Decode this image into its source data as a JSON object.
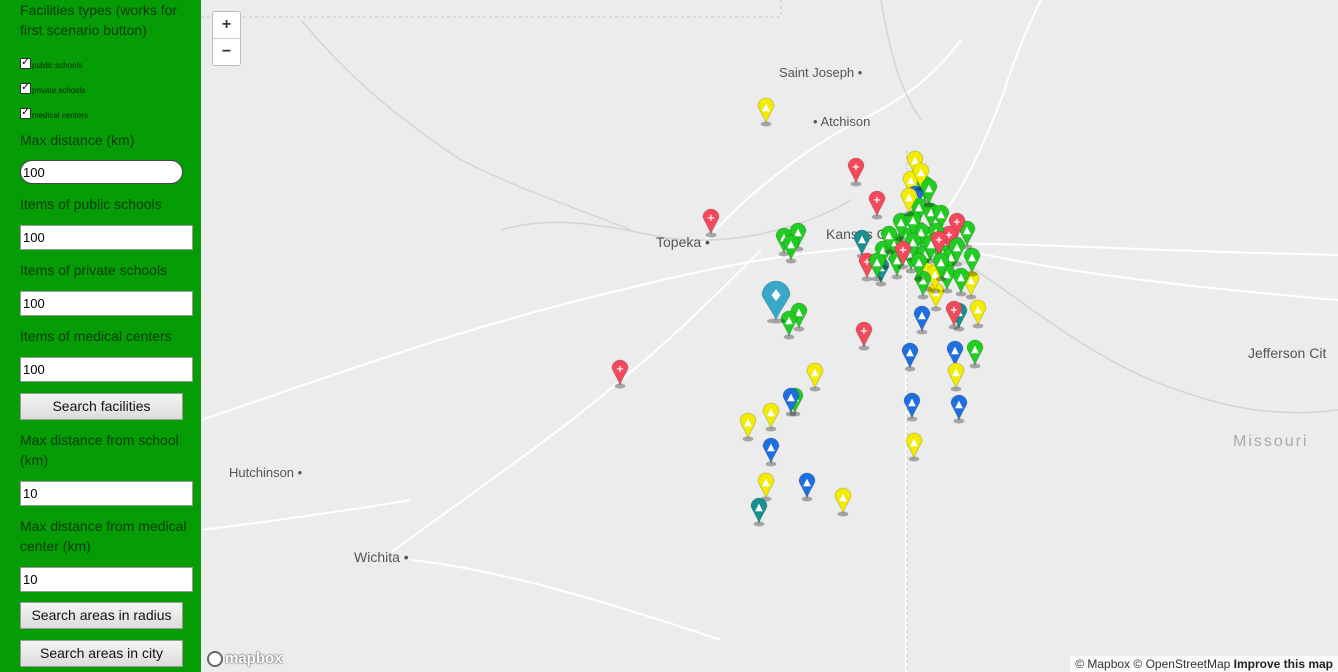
{
  "sidebar": {
    "heading": "Facilities types (works for first scenario button)",
    "checkboxes": [
      {
        "label": "public schools",
        "checked": true
      },
      {
        "label": "private schools",
        "checked": true
      },
      {
        "label": "medical centers",
        "checked": true
      }
    ],
    "max_distance_label": "Max distance (km)",
    "max_distance_value": "100",
    "public_items_label": "Items of public schools",
    "public_items_value": "100",
    "private_items_label": "Items of private schools",
    "private_items_value": "100",
    "medical_items_label": "Items of medical centers",
    "medical_items_value": "100",
    "search_facilities_button": "Search facilities",
    "max_from_school_label": "Max distance from school (km)",
    "max_from_school_value": "10",
    "max_from_medical_label": "Max distance from medical center (km)",
    "max_from_medical_value": "10",
    "search_radius_button": "Search areas in radius",
    "search_city_button": "Search areas in city"
  },
  "map": {
    "zoom_in": "+",
    "zoom_out": "−",
    "cities": [
      "Saint Joseph",
      "Atchison",
      "Topeka",
      "Kansas C",
      "Jefferson Cit",
      "Hutchinson",
      "Wichita"
    ],
    "region_label": "Missouri",
    "logo_text": "mapbox",
    "attribution": {
      "mapbox": "© Mapbox",
      "osm": "© OpenStreetMap",
      "improve": "Improve this map"
    },
    "colors": {
      "public_school": "#f2ec00",
      "private_school": "#22cc22",
      "private_school_blue": "#1f6fe0",
      "teal_school": "#1a8f8f",
      "medical_center": "#f24a5c",
      "person": "#3aa8c8"
    }
  }
}
